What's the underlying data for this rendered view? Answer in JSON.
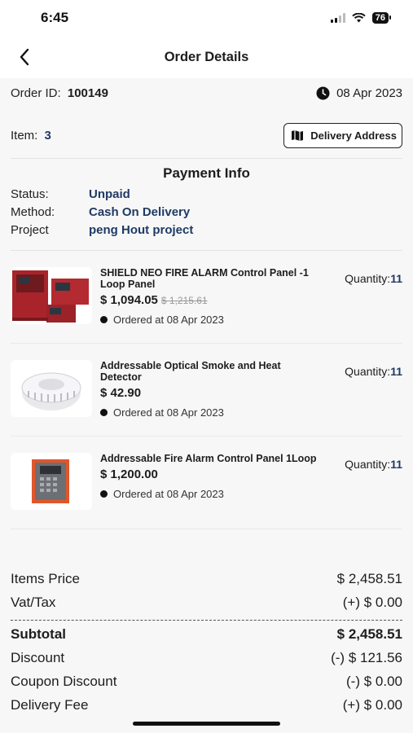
{
  "status_bar": {
    "time": "6:45",
    "battery": "76"
  },
  "header": {
    "title": "Order Details"
  },
  "order": {
    "id_label": "Order ID:",
    "id_value": "100149",
    "date": "08 Apr 2023",
    "item_label": "Item:",
    "item_count": "3",
    "delivery_button": "Delivery Address"
  },
  "payment": {
    "title": "Payment Info",
    "status_label": "Status:",
    "status_value": "Unpaid",
    "method_label": "Method:",
    "method_value": "Cash On Delivery",
    "project_label": "Project",
    "project_value": "peng Hout project"
  },
  "products": [
    {
      "name": "SHIELD NEO FIRE ALARM Control Panel -1 Loop Panel",
      "price": "$ 1,094.05",
      "old_price": "$ 1,215.61",
      "ordered": "Ordered at 08 Apr 2023",
      "qty_label": "Quantity:",
      "qty": "11"
    },
    {
      "name": "Addressable Optical Smoke and Heat Detector",
      "price": "$ 42.90",
      "old_price": "",
      "ordered": "Ordered at 08 Apr 2023",
      "qty_label": "Quantity:",
      "qty": "11"
    },
    {
      "name": "Addressable Fire Alarm Control Panel 1Loop",
      "price": "$ 1,200.00",
      "old_price": "",
      "ordered": "Ordered at 08 Apr 2023",
      "qty_label": "Quantity:",
      "qty": "11"
    }
  ],
  "totals": {
    "items_price_label": "Items Price",
    "items_price": "$ 2,458.51",
    "vat_label": "Vat/Tax",
    "vat": "(+) $ 0.00",
    "subtotal_label": "Subtotal",
    "subtotal": "$ 2,458.51",
    "discount_label": "Discount",
    "discount": "(-) $ 121.56",
    "coupon_label": "Coupon Discount",
    "coupon": "(-) $ 0.00",
    "delivery_label": "Delivery Fee",
    "delivery": "(+) $ 0.00"
  },
  "colors": {
    "accent": "#1f3a66",
    "background": "#f7f7f7"
  }
}
